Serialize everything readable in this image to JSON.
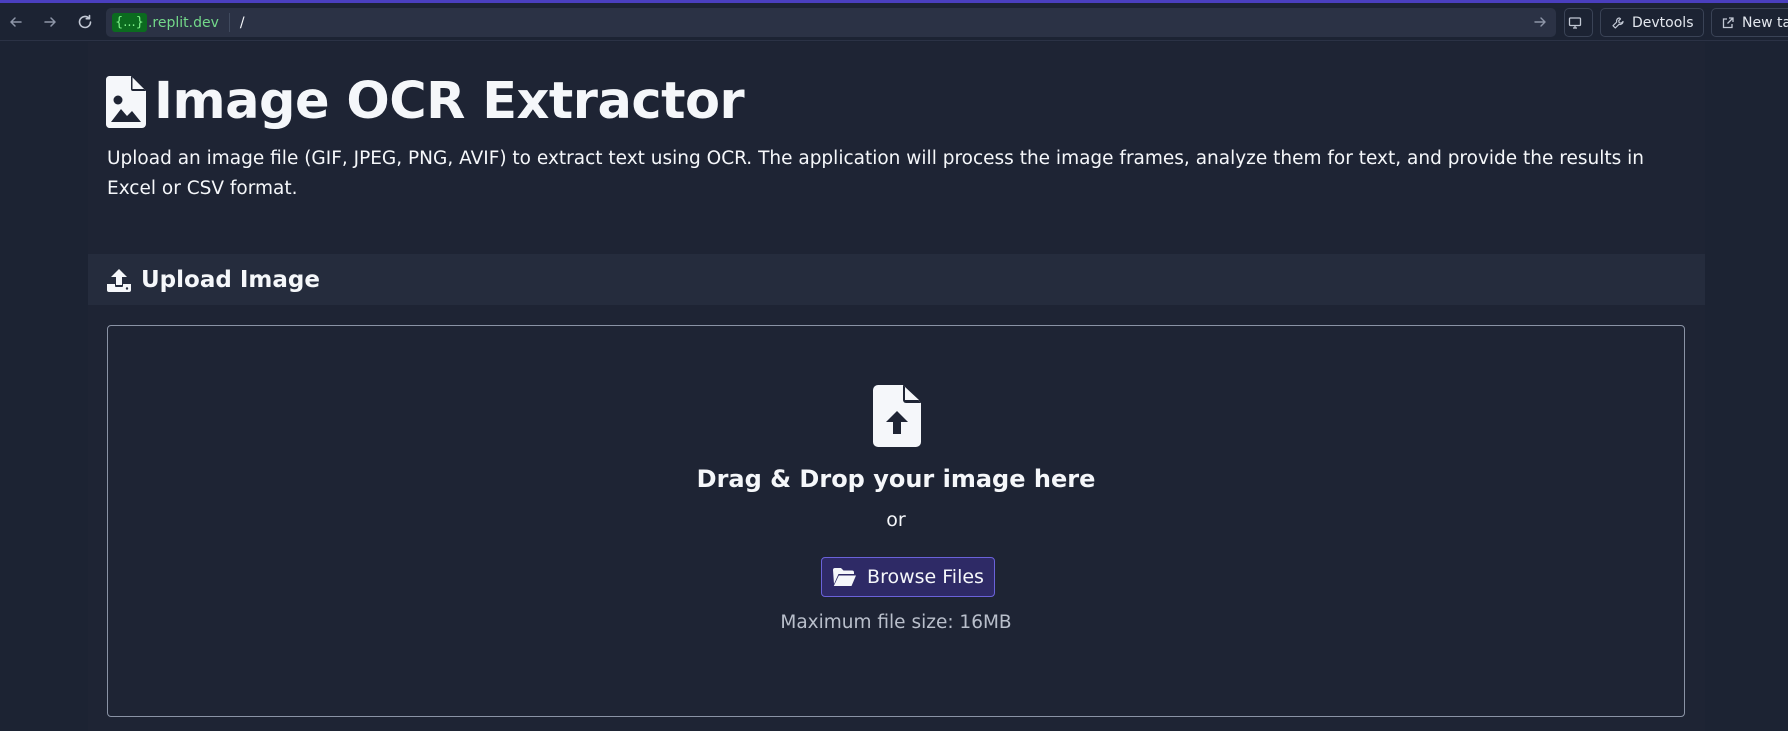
{
  "browser": {
    "url_badge": "{...}",
    "url_domain": ".replit.dev",
    "url_path": "/",
    "devtools_label": "Devtools",
    "new_tab_label": "New ta"
  },
  "app": {
    "title": "Image OCR Extractor",
    "description": "Upload an image file (GIF, JPEG, PNG, AVIF) to extract text using OCR. The application will process the image frames, analyze them for text, and provide the results in Excel or CSV format."
  },
  "upload": {
    "header": "Upload Image",
    "drop_title": "Drag & Drop your image here",
    "or_text": "or",
    "browse_label": "Browse Files",
    "max_size_text": "Maximum file size: 16MB"
  },
  "colors": {
    "background": "#1c2333",
    "card_header": "#252c3d",
    "browse_button": "#2e2a66",
    "browse_border": "#6a62d9",
    "url_badge": "#0b6b1f"
  },
  "icons": {
    "title": "file-image-icon",
    "upload_header": "upload-icon",
    "dropzone": "file-upload-icon",
    "browse": "folder-open-icon"
  }
}
